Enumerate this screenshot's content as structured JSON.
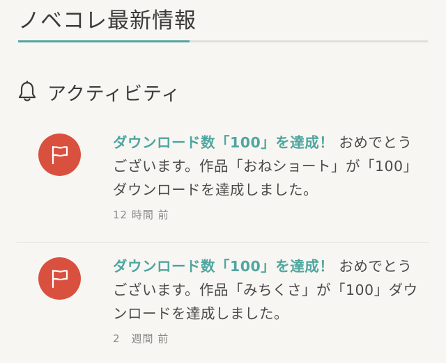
{
  "header": {
    "title": "ノベコレ最新情報"
  },
  "section": {
    "title": "アクティビティ",
    "icon": "bell-icon"
  },
  "colors": {
    "accent": "#4fa6a0",
    "avatar_bg": "#d9503f",
    "background": "#f8f6f2"
  },
  "activities": [
    {
      "icon": "flag-icon",
      "highlight": "ダウンロード数「100」を達成！",
      "message": " おめでとうございます。作品「おねショート」が「100」ダウンロードを達成しました。",
      "time": "12 時間 前"
    },
    {
      "icon": "flag-icon",
      "highlight": "ダウンロード数「100」を達成！",
      "message": " おめでとうございます。作品「みちくさ」が「100」ダウンロードを達成しました。",
      "time": "2　週間 前"
    }
  ]
}
